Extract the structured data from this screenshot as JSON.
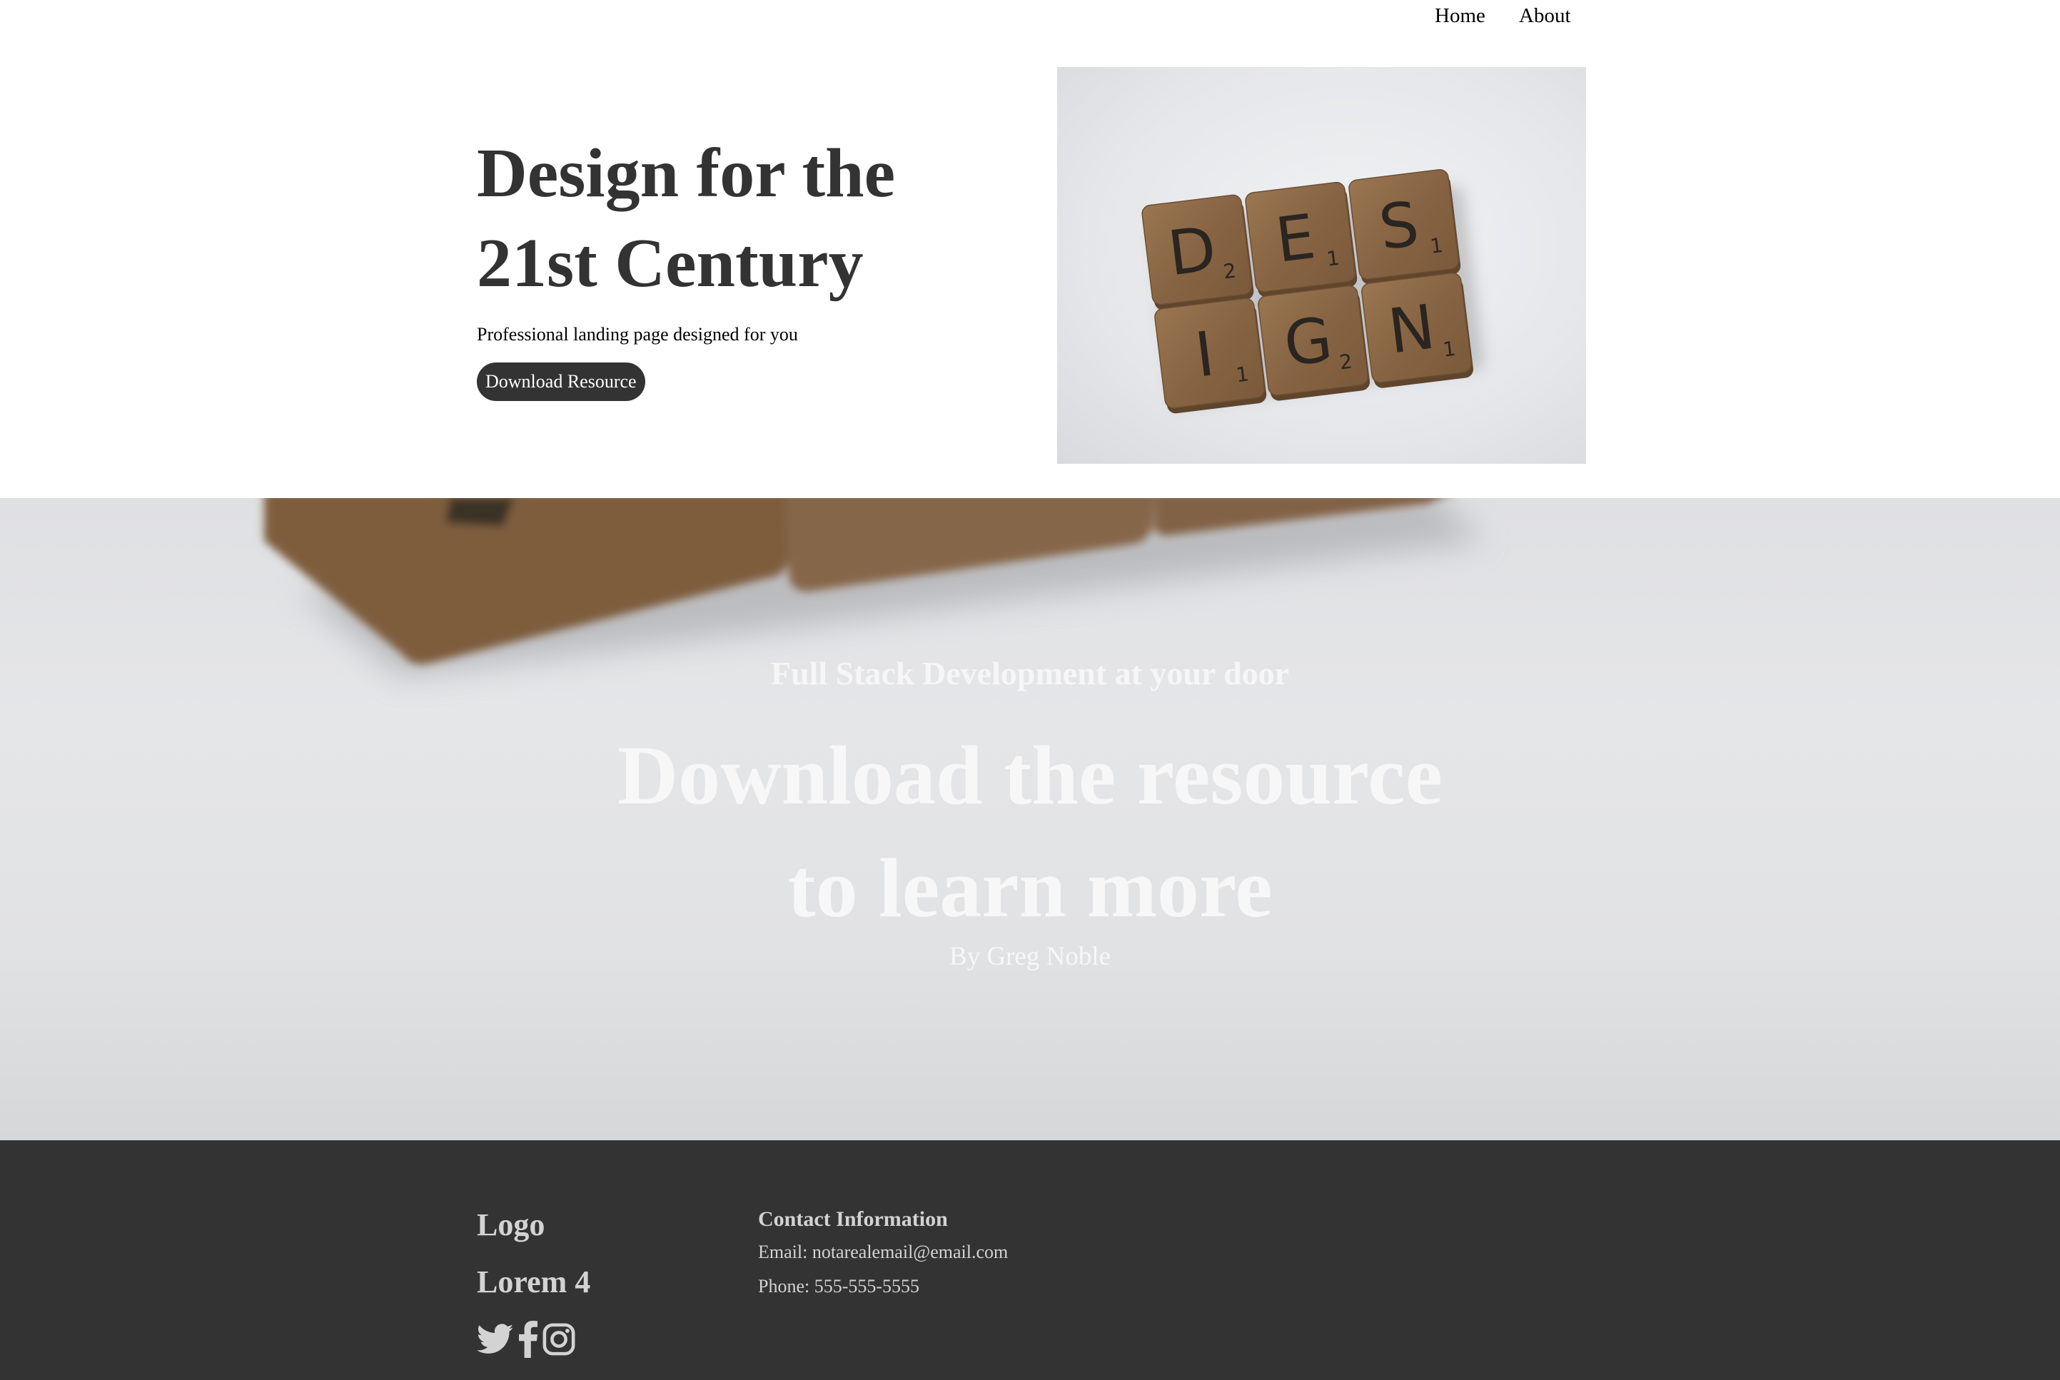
{
  "nav": {
    "items": [
      "Home",
      "About"
    ]
  },
  "hero": {
    "title": "Design for the\n21st Century",
    "subtitle": "Professional landing page designed for you",
    "button_label": "Download Resource",
    "image": {
      "tiles": [
        {
          "letter": "D",
          "score": "2"
        },
        {
          "letter": "E",
          "score": "1"
        },
        {
          "letter": "S",
          "score": "1"
        },
        {
          "letter": "I",
          "score": "1"
        },
        {
          "letter": "G",
          "score": "2"
        },
        {
          "letter": "N",
          "score": "1"
        }
      ]
    }
  },
  "cta": {
    "kicker": "Full Stack Development at your door",
    "title": "Download the resource\nto learn more",
    "byline": "By Greg Noble"
  },
  "footer": {
    "logo": "Logo",
    "lorem": "Lorem 4",
    "social_icons": [
      "twitter-icon",
      "facebook-icon",
      "instagram-icon"
    ],
    "contact": {
      "title": "Contact Information",
      "email": "Email: notarealemail@email.com",
      "phone": "Phone: 555-555-5555"
    }
  },
  "colors": {
    "dark": "#333333",
    "footer_text": "#d3d3d3",
    "cta_text": "#f7f7f8",
    "tile_wood": "#8b6a48"
  }
}
